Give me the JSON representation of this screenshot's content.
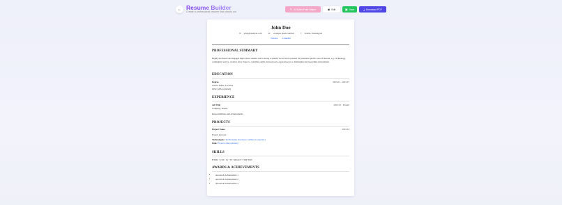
{
  "header": {
    "back_icon": "arrow-left-icon",
    "title": "Resume Builder",
    "subtitle": "Create a professional resume that stands out"
  },
  "toolbar": {
    "ai_label": "AI Bullet Point Helper",
    "edit_label": "Edit",
    "save_label": "Save",
    "pdf_label": "Download PDF"
  },
  "resume": {
    "name": "John Doe",
    "email": "john@example.com",
    "phone": "example phone number",
    "location": "Seattle, Washington",
    "link_website": "Website",
    "link_linkedin": "LinkedIn",
    "summary_title": "PROFESSIONAL SUMMARY",
    "summary_text": "Highly motivated and engaged high school student with a strong academic record and a passion for [mention specific area of interest, e.g., technology, community service, creative arts]. Eager to contribute skills and learn new experiences in a challenging and rewarding environment.",
    "education_title": "EDUCATION",
    "edu_degree": "Degree",
    "edu_dates": "2023-01 - 2023-07",
    "edu_school": "School Name, Location",
    "edu_gpa": "GPA: GPA (optional)",
    "experience_title": "EXPERIENCE",
    "exp_title": "Job Title",
    "exp_dates": "2023-01 - Present",
    "exp_company": "Company, Seattle",
    "exp_resp": "Responsibilities and Achievements",
    "projects_title": "PROJECTS",
    "proj_name": "Project Name",
    "proj_date": "2023-01",
    "proj_role": "Project and role.",
    "proj_tech_label": "Technologies:",
    "proj_tech": "Technologies Used (use commas to separate)",
    "proj_link_label": "Link:",
    "proj_link": "Project Link (optional)",
    "skills_title": "SKILLS",
    "skills_text": "HTML • CSS • JS • TS • REACT • SKETCH",
    "awards_title": "AWARDS & ACHIEVEMENTS",
    "awards": [
      "Awards & Achievement 1",
      "Awards & Achievement 2",
      "Awards & Achievement 3"
    ]
  },
  "colors": {
    "accent": "#8b5cf6",
    "ai_button": "#f4a8c7",
    "save_button": "#22c55e",
    "pdf_button": "#4f46e5",
    "link": "#2563eb"
  }
}
